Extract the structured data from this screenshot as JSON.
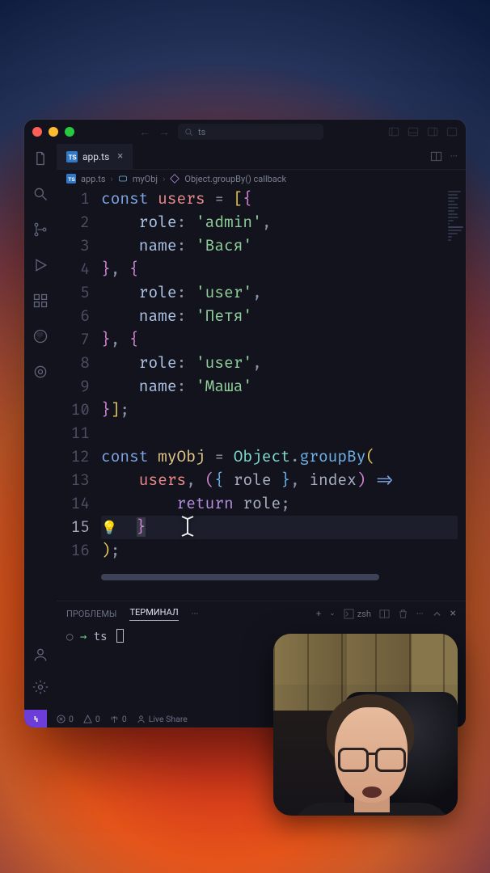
{
  "titlebar": {
    "search_text": "ts"
  },
  "tab": {
    "filename": "app.ts",
    "close_glyph": "×"
  },
  "breadcrumbs": {
    "file": "app.ts",
    "sym1": "myObj",
    "sym2": "Object.groupBy() callback",
    "chev": "›"
  },
  "code": {
    "lines": [
      "1",
      "2",
      "3",
      "4",
      "5",
      "6",
      "7",
      "8",
      "9",
      "10",
      "11",
      "12",
      "13",
      "14",
      "15",
      "16"
    ],
    "const": "const",
    "users": "users",
    "myObj": "myObj",
    "Object": "Object",
    "groupBy": "groupBy",
    "role": "role",
    "name": "name",
    "index": "index",
    "return": "return",
    "eq": " = ",
    "admin": "'admin'",
    "user": "'user'",
    "n1": "'Вася'",
    "n2": "'Петя'",
    "n3": "'Маша'"
  },
  "panel": {
    "tab_problems": "ПРОБЛЕМЫ",
    "tab_terminal": "ТЕРМИНАЛ",
    "more": "···",
    "shell": "zsh",
    "plus": "+"
  },
  "terminal": {
    "arrow": "→",
    "cwd": "ts"
  },
  "status": {
    "errors": "0",
    "warnings": "0",
    "ports": "0",
    "live_share": "Live Share"
  }
}
